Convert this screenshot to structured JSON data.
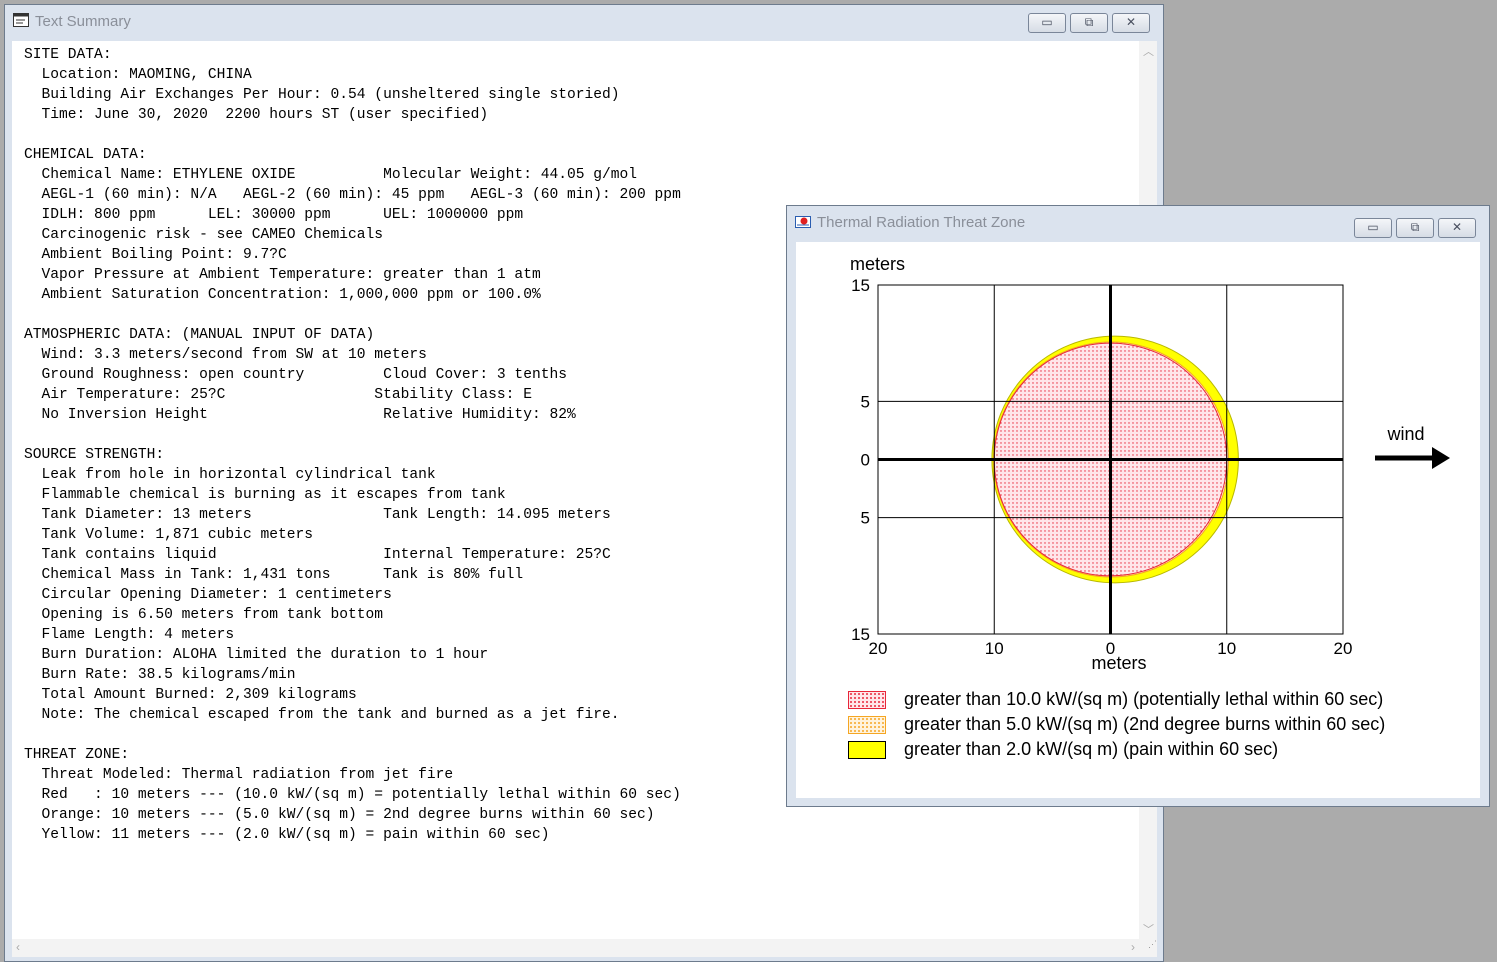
{
  "text_window": {
    "title": "Text Summary",
    "lines": [
      "SITE DATA:",
      "  Location: MAOMING, CHINA",
      "  Building Air Exchanges Per Hour: 0.54 (unsheltered single storied)",
      "  Time: June 30, 2020  2200 hours ST (user specified)",
      "",
      "CHEMICAL DATA:",
      "  Chemical Name: ETHYLENE OXIDE          Molecular Weight: 44.05 g/mol",
      "  AEGL-1 (60 min): N/A   AEGL-2 (60 min): 45 ppm   AEGL-3 (60 min): 200 ppm",
      "  IDLH: 800 ppm      LEL: 30000 ppm      UEL: 1000000 ppm",
      "  Carcinogenic risk - see CAMEO Chemicals",
      "  Ambient Boiling Point: 9.7?C",
      "  Vapor Pressure at Ambient Temperature: greater than 1 atm",
      "  Ambient Saturation Concentration: 1,000,000 ppm or 100.0%",
      "",
      "ATMOSPHERIC DATA: (MANUAL INPUT OF DATA)",
      "  Wind: 3.3 meters/second from SW at 10 meters",
      "  Ground Roughness: open country         Cloud Cover: 3 tenths",
      "  Air Temperature: 25?C                 Stability Class: E",
      "  No Inversion Height                    Relative Humidity: 82%",
      "",
      "SOURCE STRENGTH:",
      "  Leak from hole in horizontal cylindrical tank",
      "  Flammable chemical is burning as it escapes from tank",
      "  Tank Diameter: 13 meters               Tank Length: 14.095 meters",
      "  Tank Volume: 1,871 cubic meters",
      "  Tank contains liquid                   Internal Temperature: 25?C",
      "  Chemical Mass in Tank: 1,431 tons      Tank is 80% full",
      "  Circular Opening Diameter: 1 centimeters",
      "  Opening is 6.50 meters from tank bottom",
      "  Flame Length: 4 meters",
      "  Burn Duration: ALOHA limited the duration to 1 hour",
      "  Burn Rate: 38.5 kilograms/min",
      "  Total Amount Burned: 2,309 kilograms",
      "  Note: The chemical escaped from the tank and burned as a jet fire.",
      "",
      "THREAT ZONE:",
      "  Threat Modeled: Thermal radiation from jet fire",
      "  Red   : 10 meters --- (10.0 kW/(sq m) = potentially lethal within 60 sec)",
      "  Orange: 10 meters --- (5.0 kW/(sq m) = 2nd degree burns within 60 sec)",
      "  Yellow: 11 meters --- (2.0 kW/(sq m) = pain within 60 sec)"
    ]
  },
  "threat_window": {
    "title": "Thermal Radiation Threat Zone",
    "wind_label": "wind",
    "legend": [
      {
        "label": "greater than 10.0 kW/(sq m) (potentially lethal within 60 sec)",
        "color": "#e8263a"
      },
      {
        "label": "greater than 5.0 kW/(sq m) (2nd degree burns within 60 sec)",
        "color": "#f5a623"
      },
      {
        "label": "greater than 2.0 kW/(sq m) (pain within 60 sec)",
        "color": "#ffff00"
      }
    ]
  },
  "chart_data": {
    "type": "area",
    "xlabel": "meters",
    "ylabel": "meters",
    "xlim": [
      -20,
      20
    ],
    "ylim": [
      -15,
      15
    ],
    "x_tick_labels": [
      "20",
      "10",
      "0",
      "10",
      "20"
    ],
    "y_tick_labels": [
      "15",
      "5",
      "0",
      "5",
      "15"
    ],
    "grid": true,
    "series": [
      {
        "name": "greater than 2.0 kW/(sq m) (pain within 60 sec)",
        "color": "#ffff00",
        "center_x": 0.4,
        "radius": 10.6
      },
      {
        "name": "greater than 5.0 kW/(sq m) (2nd degree burns within 60 sec)",
        "color": "#f5a623",
        "center_x": 0.05,
        "radius": 10.1
      },
      {
        "name": "greater than 10.0 kW/(sq m) (potentially lethal within 60 sec)",
        "color": "#e8263a",
        "center_x": 0,
        "radius": 10.0
      }
    ]
  }
}
